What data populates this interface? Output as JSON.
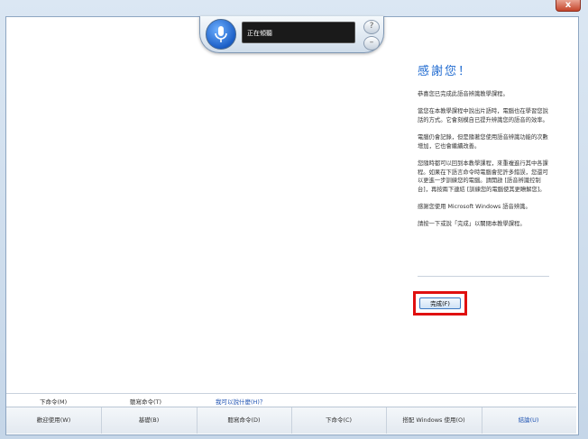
{
  "window": {
    "close_symbol": "x"
  },
  "speech": {
    "status": "正在傾聽",
    "mic_icon": "microphone-icon",
    "side_btn_top": "?",
    "side_btn_bottom": "–"
  },
  "panel": {
    "title": "感謝您！",
    "paragraphs": [
      "恭喜您已完成此語音辨識教學課程。",
      "當您在本教學課程中說出片語時，電腦也在學習您說話的方式。它會刻模自已提升辨識您的語音的效率。",
      "電腦仍會記錄，但是隨著您使用語音辨識功能的次數增加，它也會繼續改善。",
      "您隨時都可以回到本教學課程，來重複進行其中各課程。如果在下語言命令時電腦會犯許多錯誤，您還可以更進一步訓練您的電腦。請開啟 [語音辨識控制台]，再按兩下連結 [訓練您的電腦使其更瞭解您]。",
      "感謝您使用 Microsoft Windows 語音辨識。",
      "請按一下或說「完成」以關閉本教學課程。"
    ],
    "finish_label": "完成(F)"
  },
  "commands": {
    "next_command": "下命令(M)",
    "dictation_command": "聽寫命令(T)",
    "what_can_i_say": "我可以說什麼(H)？"
  },
  "nav": {
    "items": [
      "歡迎使用(W)",
      "基礎(B)",
      "聽寫命令(D)",
      "下命令(C)",
      "搭配 Windows 使用(O)",
      "結論(U)"
    ]
  }
}
